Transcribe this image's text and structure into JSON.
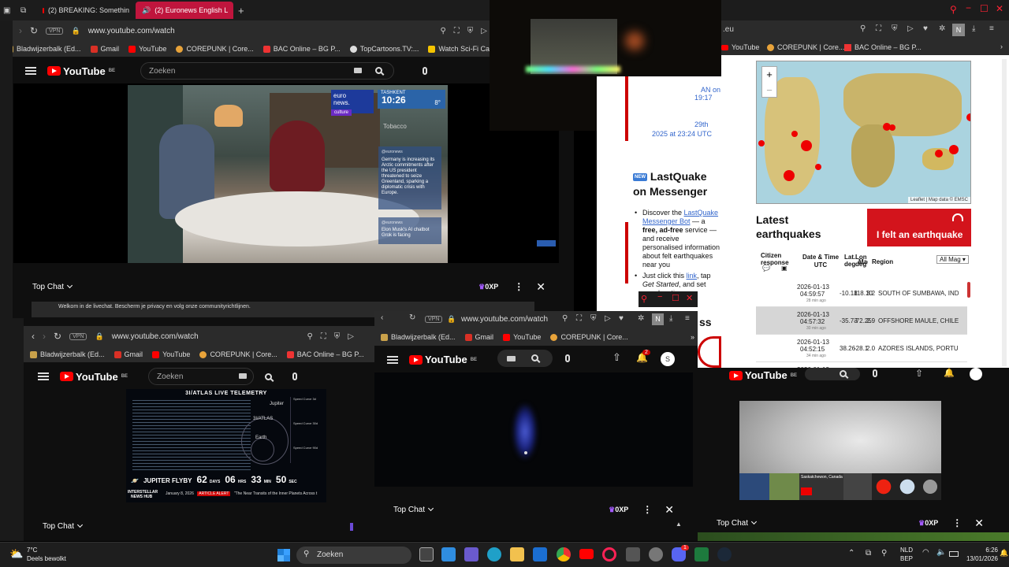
{
  "top_left_window": {
    "tabs": [
      {
        "label": "(2) BREAKING: Somethin"
      },
      {
        "label": "(2) Euronews English L"
      }
    ],
    "new_tab": "+",
    "url": "www.youtube.com/watch",
    "vpn": "VPN",
    "bookmarks": [
      "Bladwijzerbalk (Ed...",
      "Gmail",
      "YouTube",
      "COREPUNK | Core...",
      "BAC Online – BG P...",
      "TopCartoons.TV:...",
      "Watch Sci-Fi Cart"
    ],
    "search_placeholder": "Zoeken",
    "region": "BE",
    "logo": "YouTube",
    "video_overlay": {
      "city": "TASHKENT",
      "time": "10:26",
      "temp": "8°",
      "brand_line1": "euro",
      "brand_line2": "news.",
      "tag": "culture",
      "news_text": "Germany is increasing its Arctic commitments after the US president threatened to seize Greenland, sparking a diplomatic crisis with Europe.",
      "handle": "@euronews",
      "news_text2": "Elon Musk's AI chatbot Grok is facing",
      "fading": "Tobacco"
    },
    "chat": {
      "title": "Top Chat",
      "xp": "0XP",
      "welcome": "Welkom in de livechat. Bescherm je privacy en volg onze communityrichtlijnen."
    }
  },
  "quake_window": {
    "url_fragment": ".eu",
    "bookmarks": [
      "YouTube",
      "COREPUNK | Core...",
      "BAC Online – BG P..."
    ],
    "zoom_in": "+",
    "zoom_out": "−",
    "map_credit": "Leaflet | Map data © EMSC",
    "latest_title": "Latest earthquakes",
    "felt_button": "I felt an earthquake",
    "columns": [
      "Citizen response",
      "Date & Time UTC",
      "Lat. degrees",
      "Lon. degrees",
      "Mag",
      "Region"
    ],
    "filter": "All Mag",
    "rows": [
      {
        "date": "2026-01-13",
        "time": "04:59:57",
        "ago": "28 min ago",
        "lat": "-10.18",
        "lon": "118.10",
        "mag": "3.2",
        "region": "SOUTH OF SUMBAWA, IND"
      },
      {
        "date": "2026-01-13",
        "time": "04:57:32",
        "ago": "30 min ago",
        "lat": "-35.73",
        "lon": "-72.25",
        "mag": "2.9",
        "region": "OFFSHORE MAULE, CHILE"
      },
      {
        "date": "2026-01-13",
        "time": "04:52:15",
        "ago": "34 min ago",
        "lat": "38.26",
        "lon": "-28.1",
        "mag": "2.0",
        "region": "AZORES ISLANDS, PORTU"
      },
      {
        "date": "2026-01-13",
        "time": "",
        "ago": "",
        "lat": "",
        "lon": "",
        "mag": "",
        "region": ""
      }
    ]
  },
  "lastquake_window": {
    "link_fragments": [
      "AN on",
      "19:17",
      "29th",
      "2025 at 23:24 UTC"
    ],
    "new_badge": "NEW",
    "heading": "LastQuake on Messenger",
    "bullet1_pre": "Discover the ",
    "bullet1_link": "LastQuake Messenger Bot",
    "bullet1_mid": " — a ",
    "bullet1_bold": "free, ad-free",
    "bullet1_post": " service — and receive personalised information about felt earthquakes near you",
    "bullet2_pre": "Just click this ",
    "bullet2_link": "link",
    "bullet2_mid": ", tap ",
    "bullet2_em": "Get Started",
    "bullet2_post": ", and set your location.",
    "partial": "ss"
  },
  "bottom_left_window": {
    "url": "www.youtube.com/watch",
    "vpn": "VPN",
    "bookmarks": [
      "Bladwijzerbalk (Ed...",
      "Gmail",
      "YouTube",
      "COREPUNK | Core...",
      "BAC Online – BG P..."
    ],
    "search_placeholder": "Zoeken",
    "region": "BE",
    "logo": "YouTube",
    "telemetry_title": "3I/ATLAS LIVE TELEMETRY",
    "labels": [
      "Jupiter",
      "3I/ATLAS",
      "Earth"
    ],
    "speed_labels": [
      "Speed Curve 3d",
      "Speed Curve 30d",
      "Speed Curve 90d"
    ],
    "flyby": "JUPITER FLYBY",
    "countdown": [
      {
        "num": "62",
        "unit": "DAYS"
      },
      {
        "num": "06",
        "unit": "HRS"
      },
      {
        "num": "33",
        "unit": "MIN"
      },
      {
        "num": "50",
        "unit": "SEC"
      }
    ],
    "hub_line1": "INTERSTELLAR",
    "hub_line2": "NEWS HUB",
    "ticker_date": "January 8, 2026",
    "ticker_badge": "ARTICLE ALERT",
    "ticker_text": "\"The Near Transits of the Inner Planets Across t",
    "chat_title": "Top Chat"
  },
  "bottom_mid_window": {
    "url": "www.youtube.com/watch",
    "vpn": "VPN",
    "bookmarks": [
      "Bladwijzerbalk (Ed...",
      "Gmail",
      "YouTube",
      "COREPUNK | Core..."
    ],
    "avatar": "S",
    "notif_count": "2",
    "profile": "N",
    "logo": "YouTube",
    "region": "BE",
    "chat_title": "Top Chat",
    "xp": "0XP"
  },
  "bottom_right_window": {
    "logo": "YouTube",
    "region": "BE",
    "thumb_label": "Saskatchewon, Canada",
    "chat_title": "Top Chat",
    "xp": "0XP"
  },
  "taskbar": {
    "temp": "7°C",
    "weather": "Deels bewolkt",
    "search": "Zoeken",
    "lang1": "NLD",
    "lang2": "BEP",
    "time": "6:26",
    "date": "13/01/2026",
    "discord_badge": "1"
  }
}
